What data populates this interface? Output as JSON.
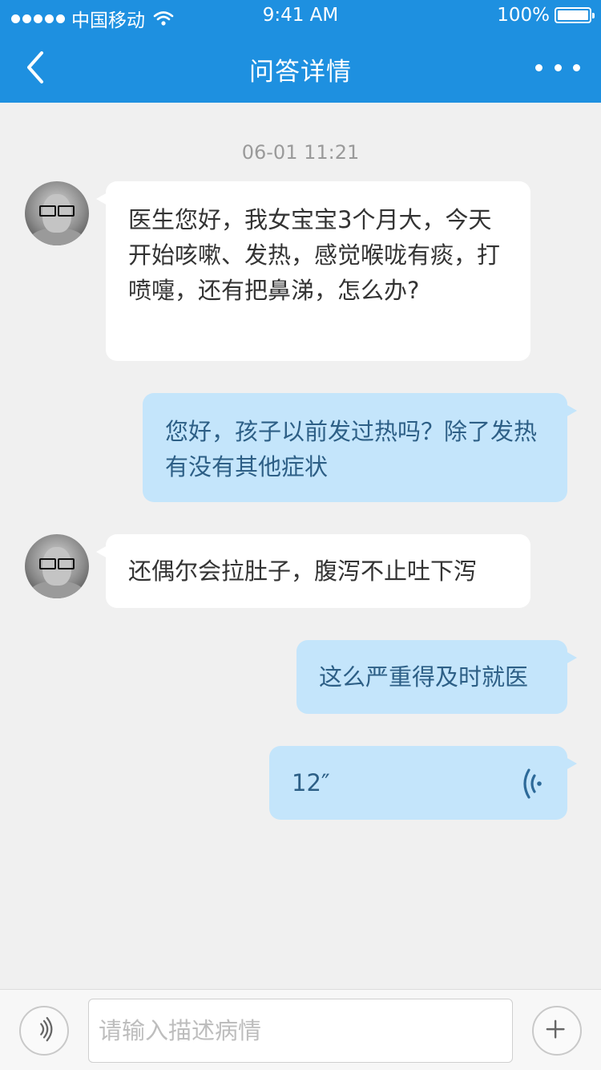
{
  "status_bar": {
    "carrier": "中国移动",
    "time": "9:41 AM",
    "battery": "100%"
  },
  "nav": {
    "title": "问答详情"
  },
  "chat": {
    "timestamp": "06-01 11:21",
    "messages": [
      {
        "side": "left",
        "text": "医生您好，我女宝宝3个月大，今天开始咳嗽、发热，感觉喉咙有痰，打喷嚏，还有把鼻涕，怎么办?"
      },
      {
        "side": "right",
        "text": "您好，孩子以前发过热吗？除了发热有没有其他症状"
      },
      {
        "side": "left",
        "text": "还偶尔会拉肚子，腹泻不止吐下泻"
      },
      {
        "side": "right",
        "text": "这么严重得及时就医"
      },
      {
        "side": "right",
        "type": "voice",
        "duration": "12″"
      }
    ]
  },
  "input": {
    "placeholder": "请输入描述病情"
  },
  "colors": {
    "header": "#1e90e0",
    "bubble_right": "#c4e5fb",
    "bubble_left": "#ffffff",
    "background": "#f0f0f0"
  }
}
